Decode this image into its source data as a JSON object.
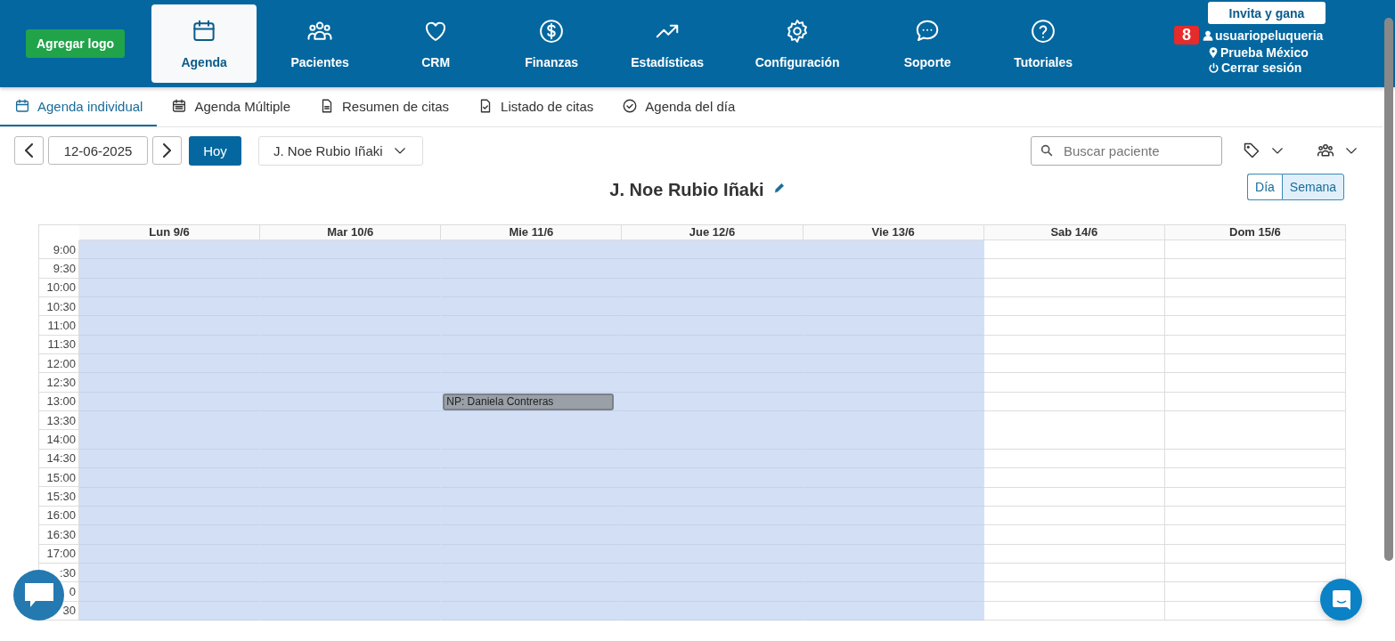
{
  "header": {
    "logo_button": "Agregar logo",
    "nav": [
      {
        "label": "Agenda",
        "selected": true
      },
      {
        "label": "Pacientes",
        "selected": false
      },
      {
        "label": "CRM",
        "selected": false
      },
      {
        "label": "Finanzas",
        "selected": false
      },
      {
        "label": "Estadísticas",
        "selected": false
      },
      {
        "label": "Configuración",
        "selected": false
      },
      {
        "label": "Soporte",
        "selected": false
      },
      {
        "label": "Tutoriales",
        "selected": false
      }
    ],
    "invite_button": "Invita y gana",
    "notifications": "8",
    "user": "usuariopeluqueria",
    "location": "Prueba México",
    "logout": "Cerrar sesión"
  },
  "subtabs": [
    {
      "label": "Agenda individual",
      "selected": true
    },
    {
      "label": "Agenda Múltiple",
      "selected": false
    },
    {
      "label": "Resumen de citas",
      "selected": false
    },
    {
      "label": "Listado de citas",
      "selected": false
    },
    {
      "label": "Agenda del día",
      "selected": false
    }
  ],
  "toolbar": {
    "date": "12-06-2025",
    "today_button": "Hoy",
    "professional": "J. Noe Rubio Iñaki",
    "search": {
      "placeholder": "Buscar paciente"
    }
  },
  "calendar": {
    "title": "J. Noe Rubio Iñaki",
    "views": [
      {
        "label": "Día",
        "selected": false
      },
      {
        "label": "Semana",
        "selected": true
      }
    ],
    "days": [
      {
        "label": "Lun 9/6",
        "available": true
      },
      {
        "label": "Mar 10/6",
        "available": true
      },
      {
        "label": "Mie 11/6",
        "available": true
      },
      {
        "label": "Jue 12/6",
        "available": true
      },
      {
        "label": "Vie 13/6",
        "available": true
      },
      {
        "label": "Sab 14/6",
        "available": false
      },
      {
        "label": "Dom 15/6",
        "available": false
      }
    ],
    "rows": [
      {
        "time": "9:00"
      },
      {
        "time": "9:30"
      },
      {
        "time": "10:00"
      },
      {
        "time": "10:30"
      },
      {
        "time": "11:00"
      },
      {
        "time": "11:30"
      },
      {
        "time": "12:00"
      },
      {
        "time": "12:30"
      },
      {
        "time": "13:00",
        "cells": [
          null,
          null,
          {
            "appointment": "NP: Daniela Contreras"
          },
          null,
          null,
          null,
          null
        ]
      },
      {
        "time": "13:30"
      },
      {
        "time": "14:00"
      },
      {
        "time": "14:30"
      },
      {
        "time": "15:00"
      },
      {
        "time": "15:30"
      },
      {
        "time": "16:00"
      },
      {
        "time": "16:30"
      },
      {
        "time": "17:00"
      },
      {
        "time": ":30"
      },
      {
        "time": "0"
      },
      {
        "time": "30"
      }
    ]
  }
}
